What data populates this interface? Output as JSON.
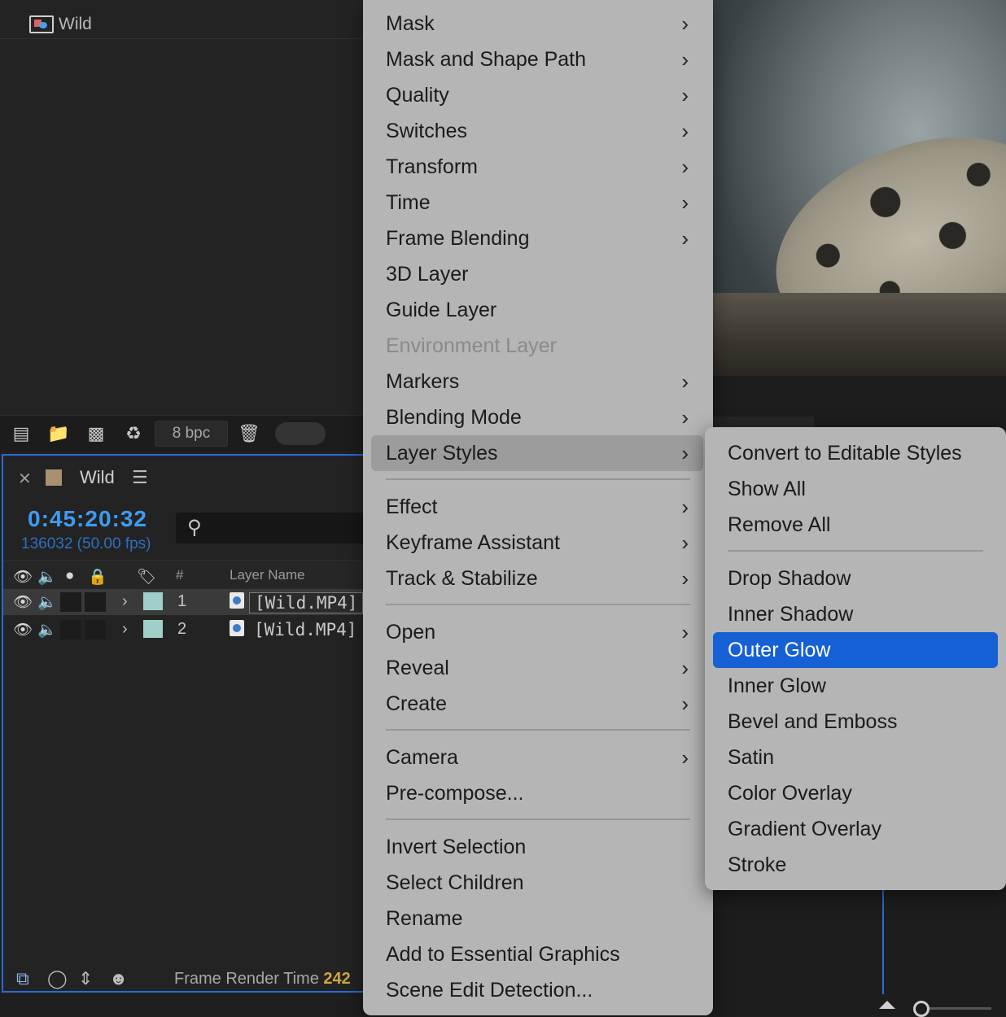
{
  "project": {
    "item_name": "Wild",
    "bpc_label": "8 bpc"
  },
  "timeline": {
    "tab_title": "Wild",
    "timecode": "0:45:20:32",
    "frame_info": "136032 (50.00 fps)",
    "columns": {
      "number": "#",
      "layer_name": "Layer Name"
    },
    "layers": [
      {
        "number": "1",
        "name": "[Wild.MP4]",
        "label_color": "#9fcfc8",
        "selected": true
      },
      {
        "number": "2",
        "name": "[Wild.MP4]",
        "label_color": "#9fcfc8",
        "selected": false
      }
    ],
    "footer": {
      "frame_render_label": "Frame Render Time",
      "frame_render_value": "242"
    }
  },
  "context_menu": {
    "items": [
      {
        "label": "Mask",
        "submenu": true
      },
      {
        "label": "Mask and Shape Path",
        "submenu": true
      },
      {
        "label": "Quality",
        "submenu": true
      },
      {
        "label": "Switches",
        "submenu": true
      },
      {
        "label": "Transform",
        "submenu": true
      },
      {
        "label": "Time",
        "submenu": true
      },
      {
        "label": "Frame Blending",
        "submenu": true
      },
      {
        "label": "3D Layer",
        "submenu": false
      },
      {
        "label": "Guide Layer",
        "submenu": false
      },
      {
        "label": "Environment Layer",
        "submenu": false,
        "disabled": true
      },
      {
        "label": "Markers",
        "submenu": true
      },
      {
        "label": "Blending Mode",
        "submenu": true
      },
      {
        "label": "Layer Styles",
        "submenu": true,
        "active": true
      },
      {
        "label": "Effect",
        "submenu": true
      },
      {
        "label": "Keyframe Assistant",
        "submenu": true
      },
      {
        "label": "Track & Stabilize",
        "submenu": true
      },
      {
        "label": "Open",
        "submenu": true
      },
      {
        "label": "Reveal",
        "submenu": true
      },
      {
        "label": "Create",
        "submenu": true
      },
      {
        "label": "Camera",
        "submenu": true
      },
      {
        "label": "Pre-compose...",
        "submenu": false
      },
      {
        "label": "Invert Selection",
        "submenu": false
      },
      {
        "label": "Select Children",
        "submenu": false
      },
      {
        "label": "Rename",
        "submenu": false
      },
      {
        "label": "Add to Essential Graphics",
        "submenu": false
      },
      {
        "label": "Scene Edit Detection...",
        "submenu": false
      }
    ]
  },
  "layer_styles_submenu": {
    "items": [
      {
        "label": "Convert to Editable Styles"
      },
      {
        "label": "Show All"
      },
      {
        "label": "Remove All"
      },
      {
        "label": "Drop Shadow"
      },
      {
        "label": "Inner Shadow"
      },
      {
        "label": "Outer Glow",
        "highlighted": true
      },
      {
        "label": "Inner Glow"
      },
      {
        "label": "Bevel and Emboss"
      },
      {
        "label": "Satin"
      },
      {
        "label": "Color Overlay"
      },
      {
        "label": "Gradient Overlay"
      },
      {
        "label": "Stroke"
      }
    ]
  },
  "colors": {
    "accent_blue": "#1660d6",
    "timecode_blue": "#3f9bf2",
    "menu_bg": "#b5b5b5"
  }
}
